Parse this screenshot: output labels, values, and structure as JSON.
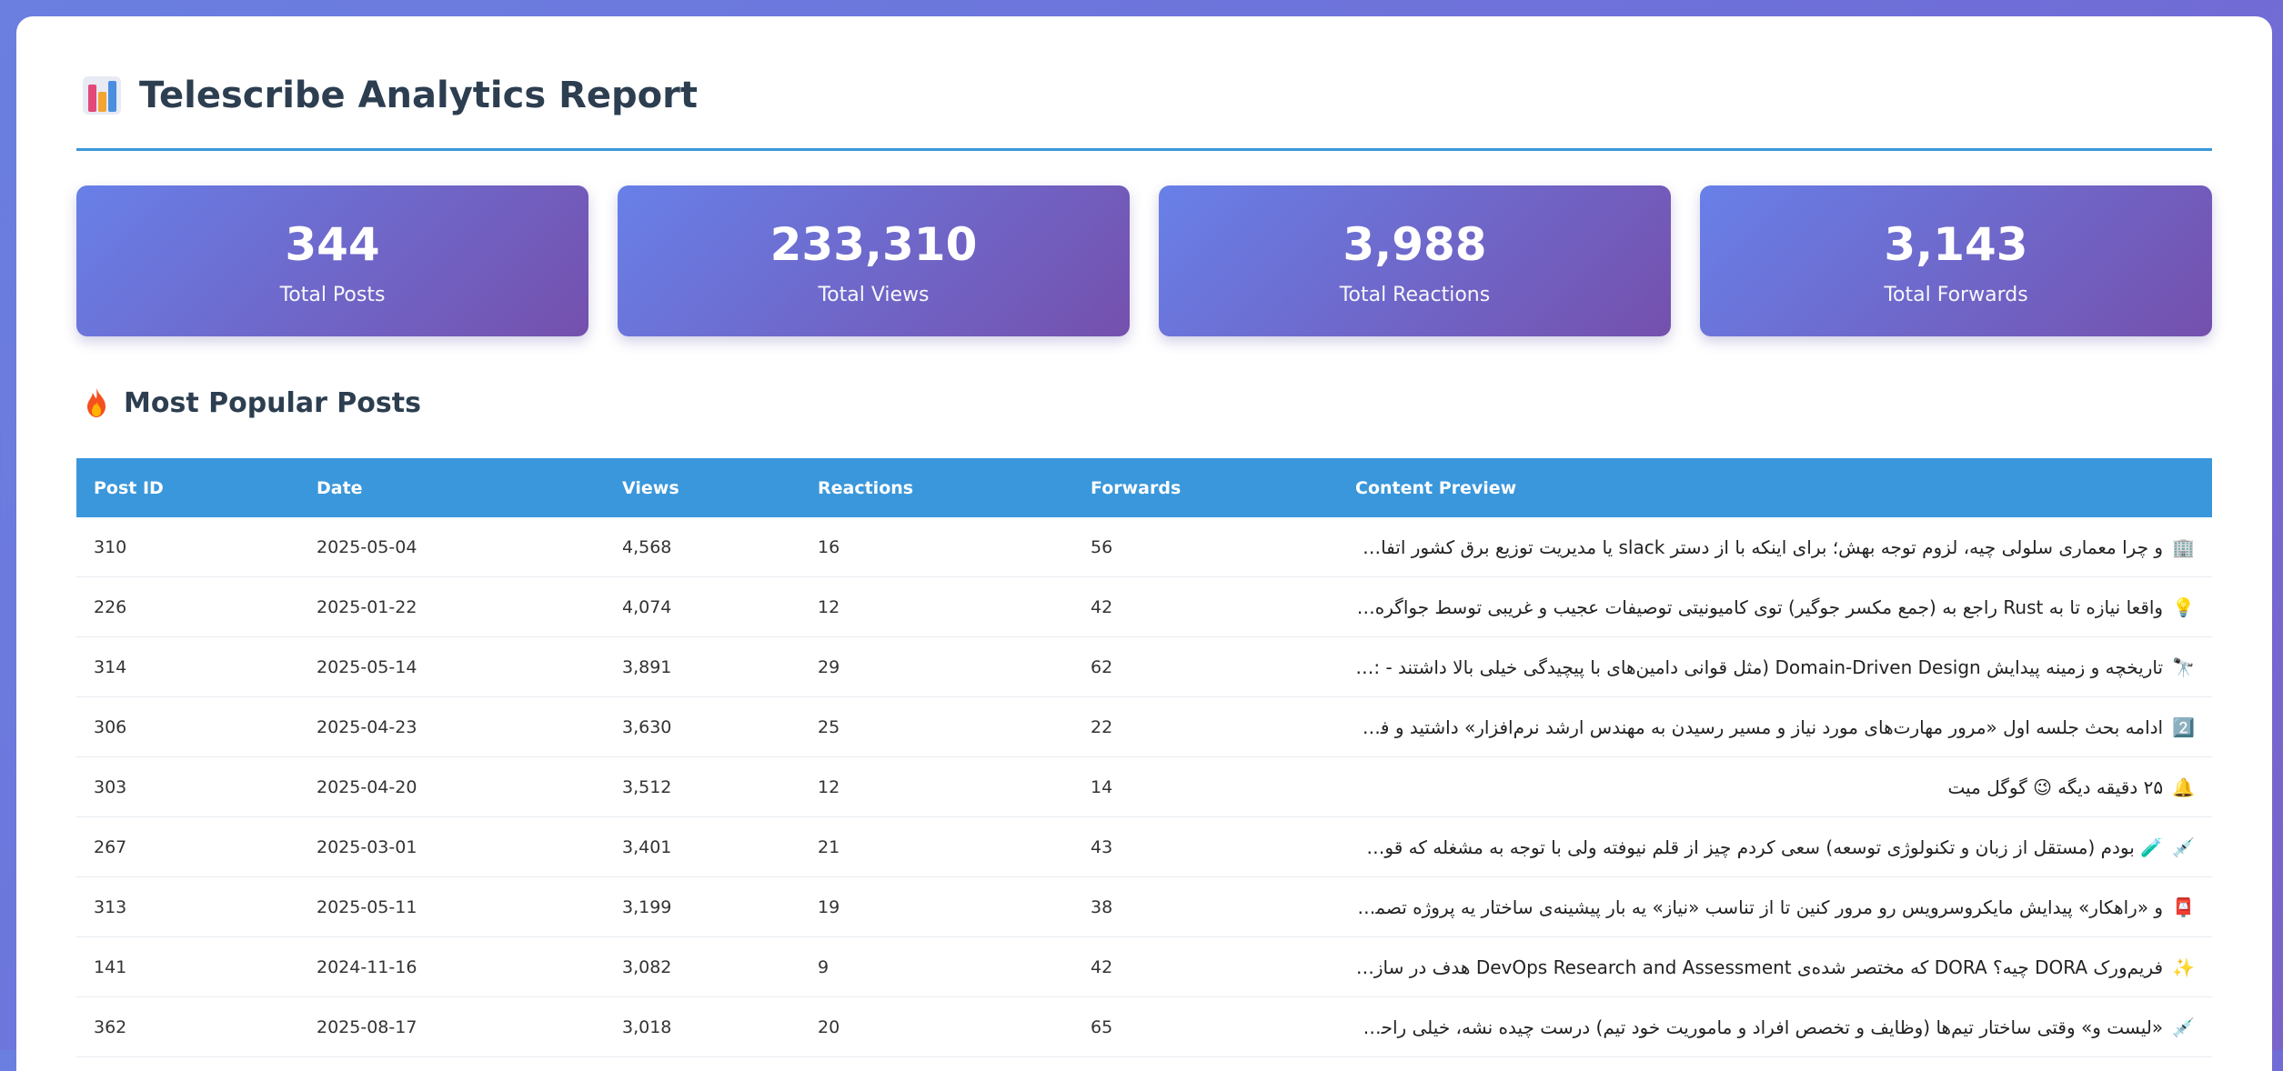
{
  "report": {
    "title": "Telescribe Analytics Report"
  },
  "stats": [
    {
      "value": "344",
      "label": "Total Posts"
    },
    {
      "value": "233,310",
      "label": "Total Views"
    },
    {
      "value": "3,988",
      "label": "Total Reactions"
    },
    {
      "value": "3,143",
      "label": "Total Forwards"
    }
  ],
  "popular": {
    "title": "Most Popular Posts",
    "columns": [
      "Post ID",
      "Date",
      "Views",
      "Reactions",
      "Forwards",
      "Content Preview"
    ],
    "rows": [
      {
        "id": "310",
        "date": "2025-05-04",
        "views": "4,568",
        "reactions": "16",
        "forwards": "56",
        "emoji": "🏢",
        "preview": "و چرا معماری سلولی چیه، لزوم توجه بهش؛ برای اینکه با از دستر slack یا مدیریت توزیع برق کشور اتفاق نیوفتاده"
      },
      {
        "id": "226",
        "date": "2025-01-22",
        "views": "4,074",
        "reactions": "12",
        "forwards": "42",
        "emoji": "💡",
        "preview": "واقعا نیازه تا به Rust راجع به (جمع مکسر جوگیر) توی کامیونیتی توصیفات عجیب و غریبی توسط جواگره عزیز هفته"
      },
      {
        "id": "314",
        "date": "2025-05-14",
        "views": "3,891",
        "reactions": "29",
        "forwards": "62",
        "emoji": "🔭",
        "preview": "تاریخچه و زمینه پیدایش Domain-Driven Design (مثل قوانی دامین‌های با پیچیدگی خیلی بالا داشتند - :بودند که"
      },
      {
        "id": "306",
        "date": "2025-04-23",
        "views": "3,630",
        "reactions": "25",
        "forwards": "22",
        "emoji": "2️⃣",
        "preview": "ادامه بحث جلسه اول «مرور مهارت‌های مورد نیاز و مسیر رسیدن به مهندس ارشد نرم‌افزار» داشتید و فکر می‌کنید"
      },
      {
        "id": "303",
        "date": "2025-04-20",
        "views": "3,512",
        "reactions": "12",
        "forwards": "14",
        "emoji": "🔔",
        "preview": "۲۵ دقیقه دیگه 😉 گوگل میت"
      },
      {
        "id": "267",
        "date": "2025-03-01",
        "views": "3,401",
        "reactions": "21",
        "forwards": "43",
        "emoji": "💉",
        "preview": "🧪 بودم (مستقل از زبان و تکنولوژی توسعه) سعی کردم چیز از قلم نیوفته ولی با توجه به مشغله که قول داده دوره"
      },
      {
        "id": "313",
        "date": "2025-05-11",
        "views": "3,199",
        "reactions": "19",
        "forwards": "38",
        "emoji": "📮",
        "preview": "و «راهکار» پیدایش مایکروسرویس رو مرور کنین تا از تناسب «نیاز» یه بار پیشینه‌ی ساختار یه پروژه تصمیم بگیرید، و"
      },
      {
        "id": "141",
        "date": "2024-11-16",
        "views": "3,082",
        "reactions": "9",
        "forwards": "42",
        "emoji": "✨",
        "preview": "فریم‌ورک DORA چیه؟ DORA که مختصر شده‌ی DevOps Research and Assessment هدف در سازمان‌هاست. کار"
      },
      {
        "id": "362",
        "date": "2025-08-17",
        "views": "3,018",
        "reactions": "20",
        "forwards": "65",
        "emoji": "💉",
        "preview": "«لیست و» وقتی ساختار تیم‌ها (وظایف و تخصص افراد و ماموریت خود تیم) درست چیده نشه، خیلی راحت به دام"
      }
    ]
  }
}
